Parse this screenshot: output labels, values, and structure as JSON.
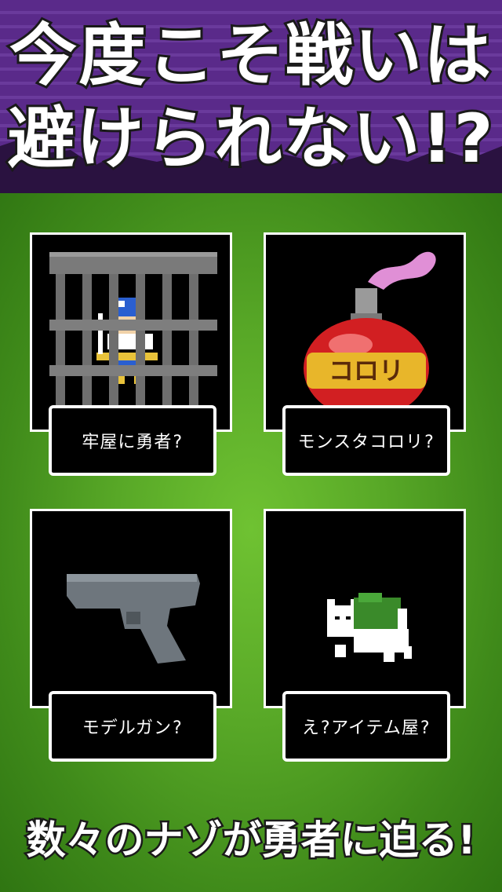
{
  "header": {
    "line1": "今度こそ戦いは",
    "line2": "避けられない!?"
  },
  "cards": [
    {
      "label": "牢屋に勇者?",
      "icon": "caged-hero-icon"
    },
    {
      "label": "モンスタコロリ?",
      "icon": "poison-bottle-icon"
    },
    {
      "label": "モデルガン?",
      "icon": "model-gun-icon"
    },
    {
      "label": "え?アイテム屋?",
      "icon": "cat-with-sack-icon"
    }
  ],
  "bottle_text": "コロリ",
  "footer": {
    "text": "数々のナゾが勇者に迫る!"
  },
  "colors": {
    "header_purple": "#5a2a8a",
    "grass_green": "#58a827",
    "card_bg": "#000000"
  }
}
